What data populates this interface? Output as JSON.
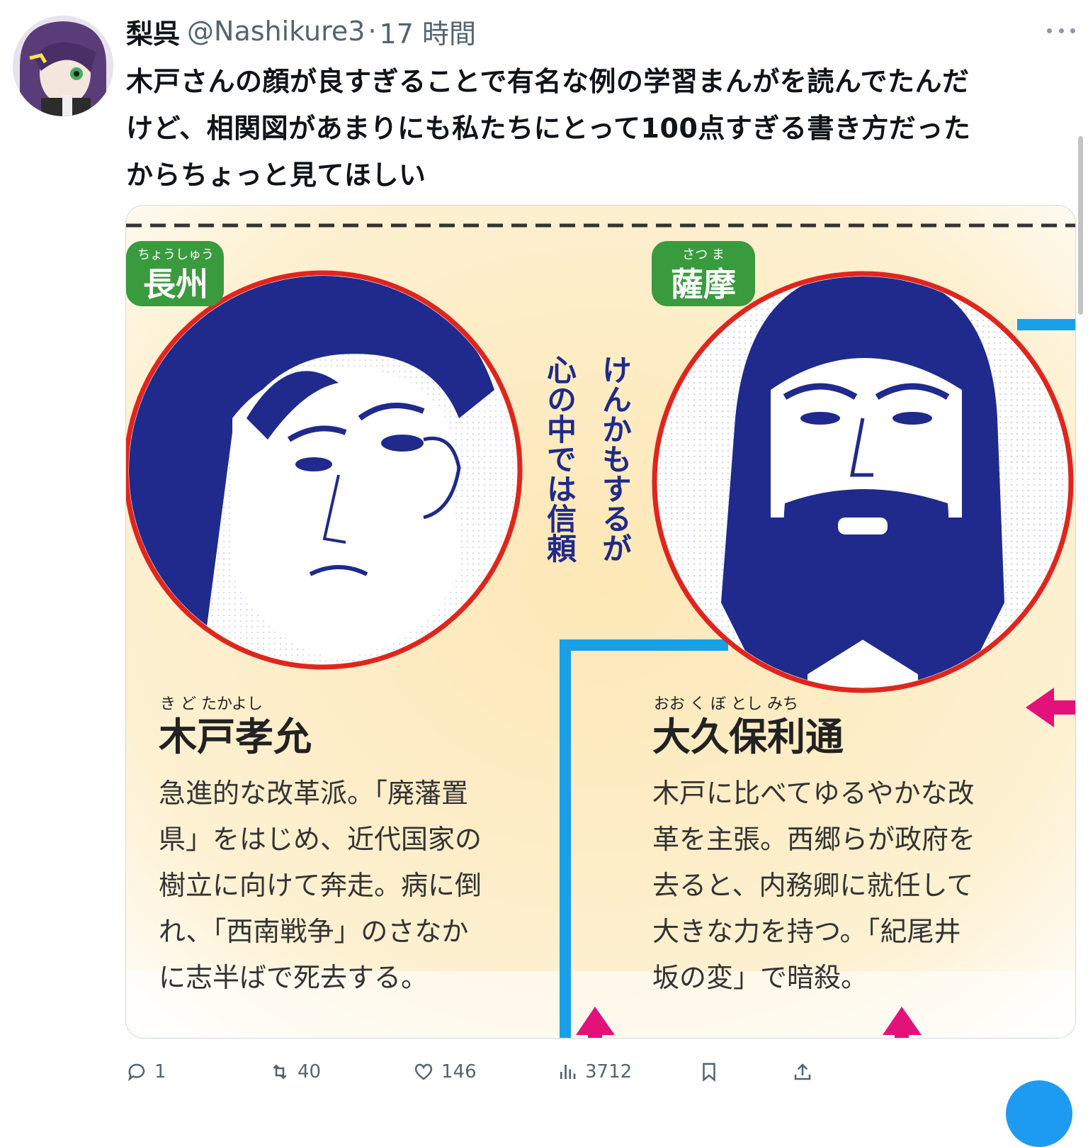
{
  "tweet": {
    "author_name": "梨呉",
    "author_handle": "@Nashikure3",
    "separator": "·",
    "time": "17 時間",
    "text": "木戸さんの顔が良すぎることで有名な例の学習まんがを読んでたんだ\nけど、相関図があまりにも私たちにとって100点すぎる書き方だった\nからちょっと見てほしい"
  },
  "media": {
    "left": {
      "region_ruby": "ちょうしゅう",
      "region": "長州",
      "name_ruby": "き ど たかよし",
      "name": "木戸孝允",
      "desc_lines": [
        "急進的な改革派。「廃藩置",
        "県」をはじめ、近代国家の",
        "樹立に向けて奔走。病に倒",
        "れ、「西南戦争」のさなか",
        "に志半ばで死去する。"
      ]
    },
    "right": {
      "region_ruby": "さつ ま",
      "region": "薩摩",
      "name_ruby": "おお く ぼ とし みち",
      "name": "大久保利通",
      "desc_lines": [
        "木戸に比べてゆるやかな改",
        "革を主張。西郷らが政府を",
        "去ると、内務卿に就任して",
        "大きな力を持つ。「紀尾井",
        "坂の変」で暗殺。"
      ]
    },
    "relation": {
      "col1": "けんかもするが",
      "col2": "心の中では信頼"
    }
  },
  "actions": {
    "reply_count": "1",
    "retweet_count": "40",
    "like_count": "146",
    "views_count": "3712"
  },
  "colors": {
    "accent": "#1d9bf0",
    "muted": "#536471",
    "panel_bg": "#fdf0cc",
    "region_green": "#3a9a3e",
    "portrait_ring": "#e0251d",
    "ink_blue": "#1f2a8c",
    "connector_blue": "#1aa0e6",
    "arrow_pink": "#e3127a"
  },
  "icons": {
    "reply": "speech-bubble-icon",
    "retweet": "retweet-icon",
    "like": "heart-icon",
    "views": "bar-chart-icon",
    "bookmark": "bookmark-icon",
    "share": "share-upload-icon",
    "more": "ellipsis-icon"
  }
}
